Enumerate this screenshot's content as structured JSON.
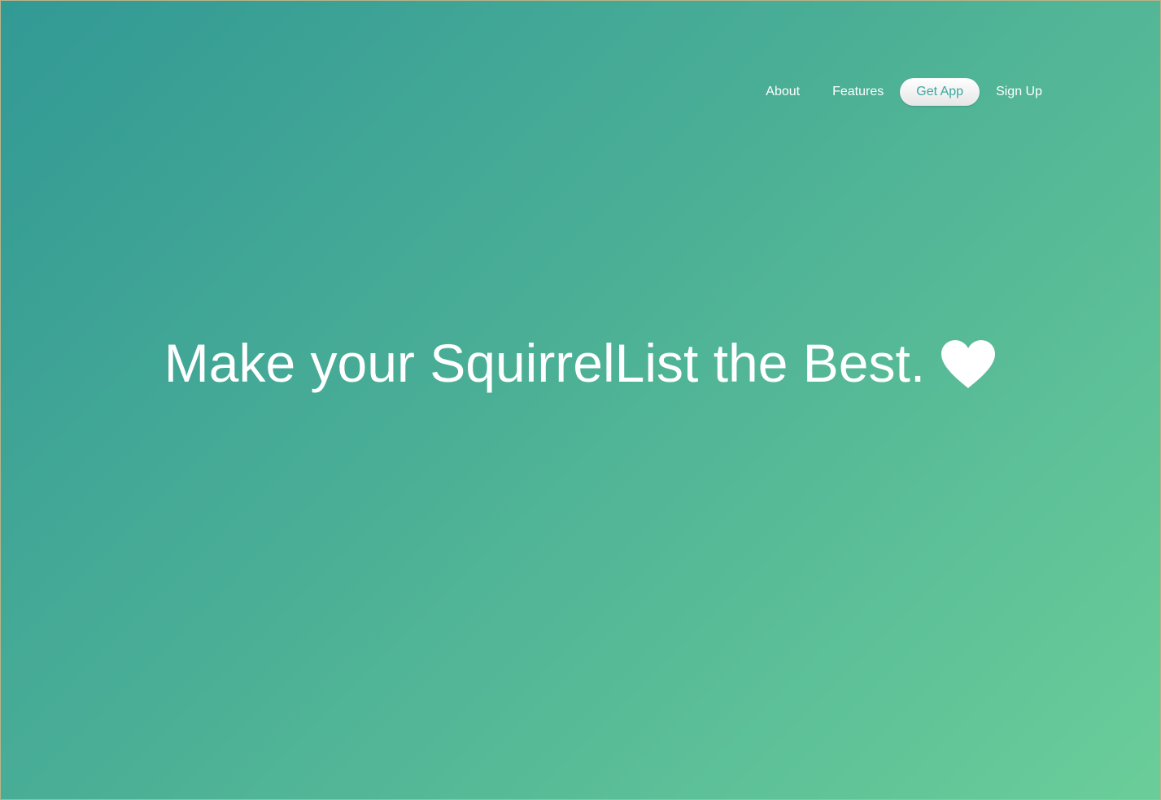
{
  "nav": {
    "items": [
      {
        "label": "About",
        "highlighted": false
      },
      {
        "label": "Features",
        "highlighted": false
      },
      {
        "label": "Get App",
        "highlighted": true
      },
      {
        "label": "Sign Up",
        "highlighted": false
      }
    ]
  },
  "hero": {
    "title": "Make your SquirrelList the Best.",
    "icon": "heart-icon"
  },
  "colors": {
    "gradient_start": "#329995",
    "gradient_end": "#6acd99",
    "text": "#ffffff",
    "pill_text": "#3aa79f"
  }
}
